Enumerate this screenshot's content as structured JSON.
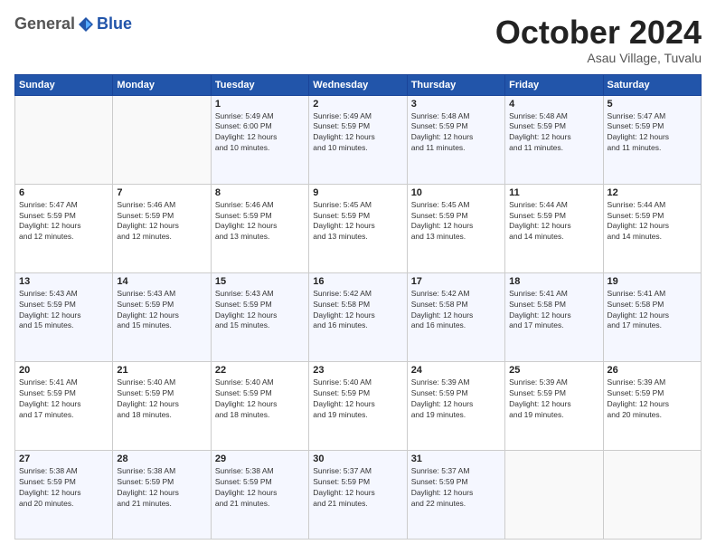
{
  "header": {
    "logo_general": "General",
    "logo_blue": "Blue",
    "month": "October 2024",
    "location": "Asau Village, Tuvalu"
  },
  "days_of_week": [
    "Sunday",
    "Monday",
    "Tuesday",
    "Wednesday",
    "Thursday",
    "Friday",
    "Saturday"
  ],
  "weeks": [
    [
      {
        "day": "",
        "info": ""
      },
      {
        "day": "",
        "info": ""
      },
      {
        "day": "1",
        "info": "Sunrise: 5:49 AM\nSunset: 6:00 PM\nDaylight: 12 hours\nand 10 minutes."
      },
      {
        "day": "2",
        "info": "Sunrise: 5:49 AM\nSunset: 5:59 PM\nDaylight: 12 hours\nand 10 minutes."
      },
      {
        "day": "3",
        "info": "Sunrise: 5:48 AM\nSunset: 5:59 PM\nDaylight: 12 hours\nand 11 minutes."
      },
      {
        "day": "4",
        "info": "Sunrise: 5:48 AM\nSunset: 5:59 PM\nDaylight: 12 hours\nand 11 minutes."
      },
      {
        "day": "5",
        "info": "Sunrise: 5:47 AM\nSunset: 5:59 PM\nDaylight: 12 hours\nand 11 minutes."
      }
    ],
    [
      {
        "day": "6",
        "info": "Sunrise: 5:47 AM\nSunset: 5:59 PM\nDaylight: 12 hours\nand 12 minutes."
      },
      {
        "day": "7",
        "info": "Sunrise: 5:46 AM\nSunset: 5:59 PM\nDaylight: 12 hours\nand 12 minutes."
      },
      {
        "day": "8",
        "info": "Sunrise: 5:46 AM\nSunset: 5:59 PM\nDaylight: 12 hours\nand 13 minutes."
      },
      {
        "day": "9",
        "info": "Sunrise: 5:45 AM\nSunset: 5:59 PM\nDaylight: 12 hours\nand 13 minutes."
      },
      {
        "day": "10",
        "info": "Sunrise: 5:45 AM\nSunset: 5:59 PM\nDaylight: 12 hours\nand 13 minutes."
      },
      {
        "day": "11",
        "info": "Sunrise: 5:44 AM\nSunset: 5:59 PM\nDaylight: 12 hours\nand 14 minutes."
      },
      {
        "day": "12",
        "info": "Sunrise: 5:44 AM\nSunset: 5:59 PM\nDaylight: 12 hours\nand 14 minutes."
      }
    ],
    [
      {
        "day": "13",
        "info": "Sunrise: 5:43 AM\nSunset: 5:59 PM\nDaylight: 12 hours\nand 15 minutes."
      },
      {
        "day": "14",
        "info": "Sunrise: 5:43 AM\nSunset: 5:59 PM\nDaylight: 12 hours\nand 15 minutes."
      },
      {
        "day": "15",
        "info": "Sunrise: 5:43 AM\nSunset: 5:59 PM\nDaylight: 12 hours\nand 15 minutes."
      },
      {
        "day": "16",
        "info": "Sunrise: 5:42 AM\nSunset: 5:58 PM\nDaylight: 12 hours\nand 16 minutes."
      },
      {
        "day": "17",
        "info": "Sunrise: 5:42 AM\nSunset: 5:58 PM\nDaylight: 12 hours\nand 16 minutes."
      },
      {
        "day": "18",
        "info": "Sunrise: 5:41 AM\nSunset: 5:58 PM\nDaylight: 12 hours\nand 17 minutes."
      },
      {
        "day": "19",
        "info": "Sunrise: 5:41 AM\nSunset: 5:58 PM\nDaylight: 12 hours\nand 17 minutes."
      }
    ],
    [
      {
        "day": "20",
        "info": "Sunrise: 5:41 AM\nSunset: 5:59 PM\nDaylight: 12 hours\nand 17 minutes."
      },
      {
        "day": "21",
        "info": "Sunrise: 5:40 AM\nSunset: 5:59 PM\nDaylight: 12 hours\nand 18 minutes."
      },
      {
        "day": "22",
        "info": "Sunrise: 5:40 AM\nSunset: 5:59 PM\nDaylight: 12 hours\nand 18 minutes."
      },
      {
        "day": "23",
        "info": "Sunrise: 5:40 AM\nSunset: 5:59 PM\nDaylight: 12 hours\nand 19 minutes."
      },
      {
        "day": "24",
        "info": "Sunrise: 5:39 AM\nSunset: 5:59 PM\nDaylight: 12 hours\nand 19 minutes."
      },
      {
        "day": "25",
        "info": "Sunrise: 5:39 AM\nSunset: 5:59 PM\nDaylight: 12 hours\nand 19 minutes."
      },
      {
        "day": "26",
        "info": "Sunrise: 5:39 AM\nSunset: 5:59 PM\nDaylight: 12 hours\nand 20 minutes."
      }
    ],
    [
      {
        "day": "27",
        "info": "Sunrise: 5:38 AM\nSunset: 5:59 PM\nDaylight: 12 hours\nand 20 minutes."
      },
      {
        "day": "28",
        "info": "Sunrise: 5:38 AM\nSunset: 5:59 PM\nDaylight: 12 hours\nand 21 minutes."
      },
      {
        "day": "29",
        "info": "Sunrise: 5:38 AM\nSunset: 5:59 PM\nDaylight: 12 hours\nand 21 minutes."
      },
      {
        "day": "30",
        "info": "Sunrise: 5:37 AM\nSunset: 5:59 PM\nDaylight: 12 hours\nand 21 minutes."
      },
      {
        "day": "31",
        "info": "Sunrise: 5:37 AM\nSunset: 5:59 PM\nDaylight: 12 hours\nand 22 minutes."
      },
      {
        "day": "",
        "info": ""
      },
      {
        "day": "",
        "info": ""
      }
    ]
  ]
}
